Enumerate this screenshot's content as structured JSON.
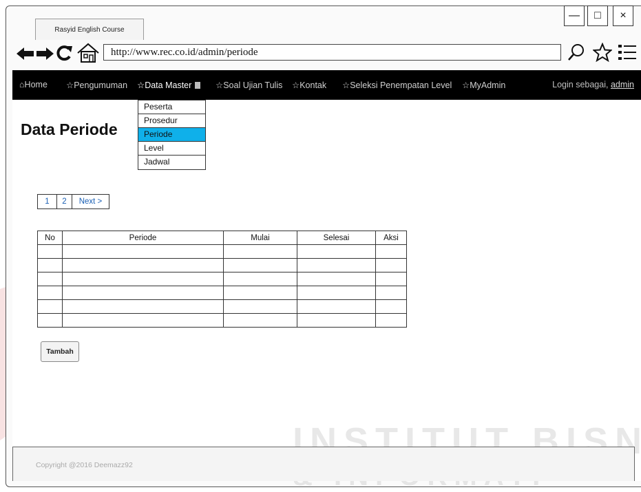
{
  "browser": {
    "tab_title": "Rasyid English Course",
    "url": "http://www.rec.co.id/admin/periode",
    "window_controls": {
      "minimize": "—",
      "maximize": "□",
      "close": "×"
    },
    "icons": {
      "back": "back-arrow-icon",
      "forward": "forward-arrow-icon",
      "reload": "reload-icon",
      "home": "home-icon",
      "search": "search-icon",
      "bookmark": "star-icon",
      "menu": "menu-icon"
    }
  },
  "nav": {
    "items": [
      {
        "label": "⌂Home"
      },
      {
        "label": "☆Pengumuman"
      },
      {
        "label": "☆Data Master"
      },
      {
        "label": "☆Soal Ujian Tulis"
      },
      {
        "label": "☆Kontak"
      },
      {
        "label": "☆Seleksi Penempatan Level"
      },
      {
        "label": "☆MyAdmin"
      }
    ],
    "login_prefix": "Login sebagai,",
    "login_user": "admin"
  },
  "dropdown": {
    "options": [
      "Peserta",
      "Prosedur",
      "Periode",
      "Level",
      "Jadwal"
    ],
    "selected": "Periode"
  },
  "page": {
    "title": "Data Periode"
  },
  "pagination": {
    "pages": [
      "1",
      "2"
    ],
    "next": "Next >"
  },
  "table": {
    "headers": [
      "No",
      "Periode",
      "Mulai",
      "Selesai",
      "Aksi"
    ],
    "empty_rows": 6
  },
  "actions": {
    "add_label": "Tambah"
  },
  "footer": {
    "copyright": "Copyright @2016 Deemazz92"
  },
  "watermark": {
    "line1": "INSTITUT BISN",
    "line2": "& INFORMATI"
  },
  "colors": {
    "navbar_bg": "#000000",
    "dropdown_highlight": "#0fb0ea",
    "link": "#1a5fb4"
  }
}
